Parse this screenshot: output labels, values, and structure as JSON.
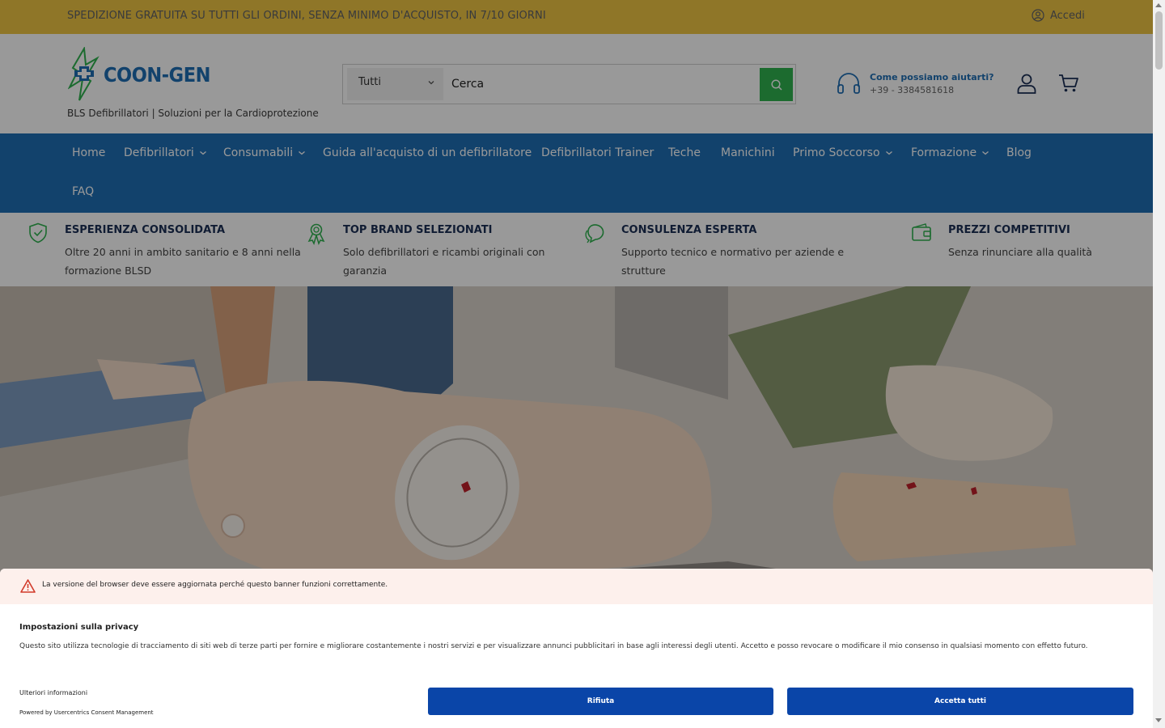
{
  "announcement": {
    "text": "SPEDIZIONE GRATUITA SU TUTTI GLI ORDINI, SENZA MINIMO D'ACQUISTO, IN 7/10 GIORNI",
    "login_label": "Accedi"
  },
  "header": {
    "logo_text": "COON-GEN",
    "tagline": "BLS Defibrillatori | Soluzioni per la Cardioprotezione",
    "search": {
      "category_selected": "Tutti",
      "placeholder": "Cerca"
    },
    "help": {
      "title": "Come possiamo aiutarti?",
      "phone": "+39 - 3384581618"
    }
  },
  "nav": {
    "items": [
      {
        "label": "Home"
      },
      {
        "label": "Defibrillatori"
      },
      {
        "label": "Consumabili"
      },
      {
        "label": "Guida all'acquisto di un defibrillatore"
      },
      {
        "label": "Defibrillatori Trainer"
      },
      {
        "label": "Teche"
      },
      {
        "label": "Manichini"
      },
      {
        "label": "Primo Soccorso"
      },
      {
        "label": "Formazione"
      },
      {
        "label": "Blog"
      },
      {
        "label": "FAQ"
      }
    ]
  },
  "usps": [
    {
      "title": "ESPERIENZA CONSOLIDATA",
      "desc1": "Oltre 20 anni in ambito sanitario e 8 anni nella",
      "desc2": "formazione BLSD",
      "icon": "shield-check-icon"
    },
    {
      "title": "TOP BRAND SELEZIONATI",
      "desc1": "Solo defibrillatori e ricambi originali con",
      "desc2": "garanzia",
      "icon": "award-icon"
    },
    {
      "title": "CONSULENZA ESPERTA",
      "desc1": "Supporto tecnico e normativo per aziende e",
      "desc2": "strutture",
      "icon": "chat-icon"
    },
    {
      "title": "PREZZI COMPETITIVI",
      "desc1": "Senza rinunciare alla qualità",
      "desc2": "",
      "icon": "wallet-icon"
    }
  ],
  "consent": {
    "warning": "La versione del browser deve essere aggiornata perché questo banner funzioni correttamente.",
    "title": "Impostazioni sulla privacy",
    "description": "Questo sito utilizza tecnologie di tracciamento di siti web di terze parti per fornire e migliorare costantemente i nostri servizi e per visualizzare annunci pubblicitari in base agli interessi degli utenti. Accetto e posso revocare o modificare il mio consenso in qualsiasi momento con effetto futuro.",
    "more_info": "Ulteriori informazioni",
    "powered_by": "Powered by Usercentrics Consent Management",
    "deny_label": "Rifiuta",
    "accept_label": "Accetta tutti"
  },
  "colors": {
    "announcement_bg": "#efc543",
    "brand_blue": "#1f6eb4",
    "brand_green": "#2fb24f",
    "consent_button": "#0a45a8"
  }
}
